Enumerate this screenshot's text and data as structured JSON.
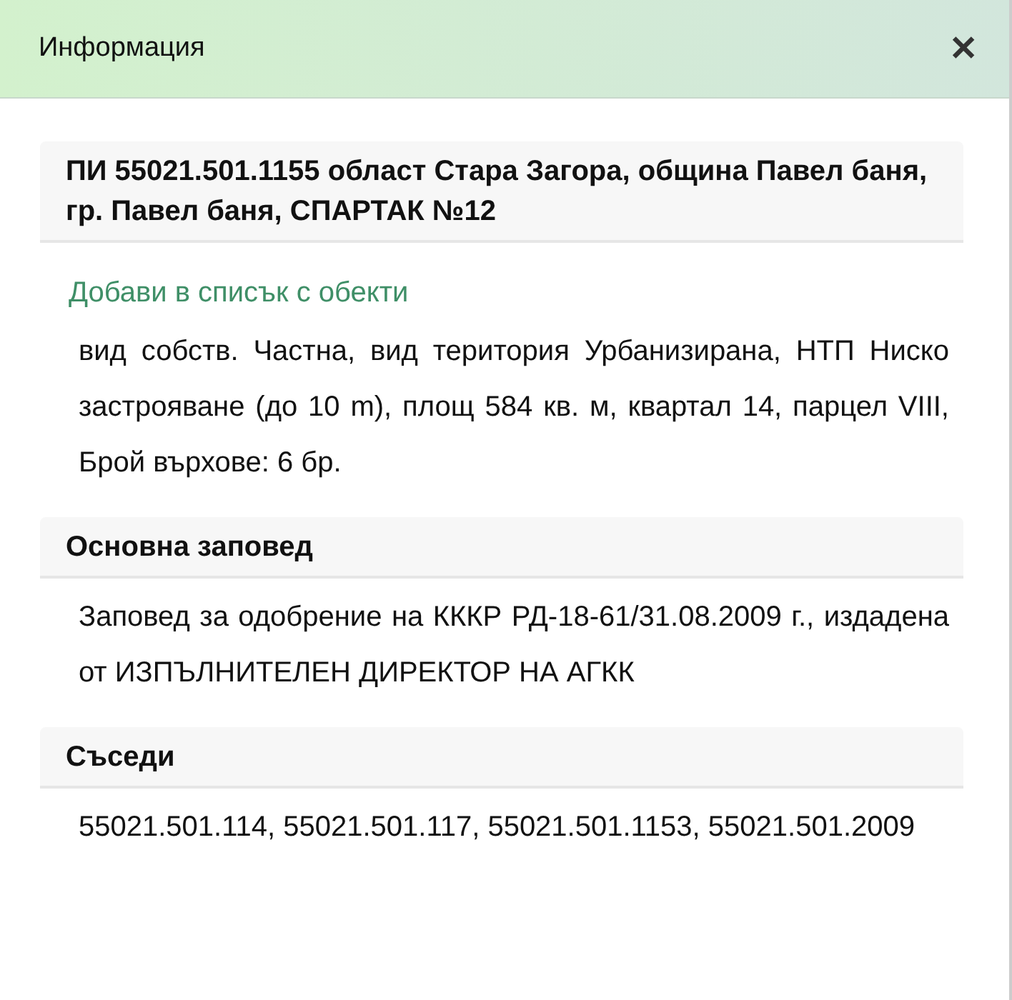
{
  "window": {
    "title": "Информация",
    "close": "✕"
  },
  "sections": [
    {
      "heading": "ПИ 55021.501.1155 област Стара Загора, община Павел баня, гр. Павел баня, СПАРТАК №12",
      "link": "Добави в списък с обекти",
      "text": "вид собств. Частна, вид територия Урбанизирана, НТП Ниско застрояване (до 10 m), площ 584 кв. м, квартал 14, парцел VIII, Брой върхове: 6 бр."
    },
    {
      "heading": "Основна заповед",
      "text": "Заповед за одобрение на КККР РД-18-61/31.08.2009 г., издадена от ИЗПЪЛНИТЕЛЕН ДИРЕКТОР НА АГКК"
    },
    {
      "heading": "Съседи",
      "text": "55021.501.114, 55021.501.117, 55021.501.1153, 55021.501.2009"
    }
  ]
}
